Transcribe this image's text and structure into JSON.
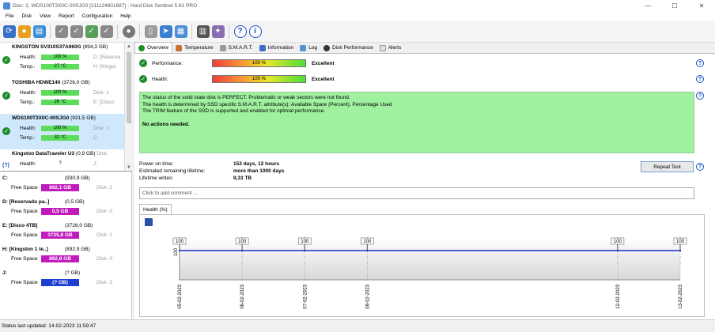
{
  "window": {
    "title": "Disc: 2, WDS100T3X0C-00SJG0 [211124801687]  -  Hard Disk Sentinel 5.61 PRO"
  },
  "menu": [
    "File",
    "Disk",
    "View",
    "Report",
    "Configuration",
    "Help"
  ],
  "disks": [
    {
      "name": "KINGSTON SV310S37A960G",
      "size": "(894,3 GB)",
      "health": "100 %",
      "temp": "27 °C",
      "side1": "D: [Reserva",
      "side2": "H: [Kingst",
      "status": "ok"
    },
    {
      "name": "TOSHIBA HDWE140",
      "size": "(3726,0 GB)",
      "health": "100 %",
      "temp": "26 °C",
      "side1": "Disk: 1",
      "side2": "E: [Disco ",
      "status": "ok"
    },
    {
      "name": "WDS100T3X0C-00SJG0",
      "size": "(931,5 GB)",
      "health": "100 %",
      "temp": "32 °C",
      "side1": "Disk: 2",
      "side2": "C:",
      "status": "ok"
    },
    {
      "name": "Kingston DataTraveler U3",
      "size": "(0,9 GB)",
      "health": "?",
      "temp": "",
      "side1": "J:",
      "side2": "",
      "side0": "Disk:",
      "status": "unknown"
    }
  ],
  "labels": {
    "health": "Health:",
    "temp": "Temp.:",
    "free_space": "Free Space"
  },
  "volumes": [
    {
      "name": "C:",
      "size": "(930,9 GB)",
      "free": "892,1 GB",
      "disk": "Disk: 2",
      "color": "#c21bbd"
    },
    {
      "name": "D: [Reservado pa..]",
      "size": "(0,5 GB)",
      "free": "0,5 GB",
      "disk": "Disk: 0",
      "color": "#c21bbd"
    },
    {
      "name": "E: [Disco  4TB]",
      "size": "(3726,0 GB)",
      "free": "3725,8 GB",
      "disk": "Disk: 1",
      "color": "#c21bbd"
    },
    {
      "name": "H: [Kingston 1 te..]",
      "size": "(892,9 GB)",
      "free": "892,8 GB",
      "disk": "Disk: 0",
      "color": "#c21bbd"
    },
    {
      "name": "J:",
      "size": "(? GB)",
      "free": "(? GB)",
      "disk": "Disk: 3",
      "color": "#1f3fd0"
    }
  ],
  "tabs": [
    "Overview",
    "Temperature",
    "S.M.A.R.T.",
    "Information",
    "Log",
    "Disk Performance",
    "Alerts"
  ],
  "overview": {
    "performance_label": "Performance:",
    "performance_value": "100 %",
    "performance_fraction": 1.0,
    "performance_text": "Excellent",
    "health_label": "Health:",
    "health_value": "100 %",
    "health_fraction": 1.0,
    "health_text": "Excellent",
    "message_lines": [
      "The status of the solid state disk is PERFECT. Problematic or weak sectors were not found.",
      "The health is determined by SSD specific S.M.A.R.T. attribute(s):  Available Spare (Percent), Percentage Used",
      "The TRIM feature of the SSD is supported and enabled for optimal performance."
    ],
    "message_bold": "No actions needed.",
    "power_on_label": "Power on time:",
    "power_on_value": "153 days, 12 hours",
    "remaining_label": "Estimated remaining lifetime:",
    "remaining_value": "more than 1000 days",
    "writes_label": "Lifetime writes:",
    "writes_value": "9,33 TB",
    "repeat_button": "Repeat Test",
    "comment_placeholder": "Click to add comment ...",
    "health_tab": "Health (%)"
  },
  "chart_data": {
    "type": "line",
    "x": [
      "05-02-2023",
      "06-02-2023",
      "07-02-2023",
      "08-02-2023",
      "12-02-2023",
      "13-02-2023"
    ],
    "y": [
      100,
      100,
      100,
      100,
      100,
      100
    ],
    "data_labels": [
      "100",
      "100",
      "100",
      "100",
      "100",
      "100"
    ],
    "ytick": "100",
    "series_color": "#1e2fc8"
  },
  "status": {
    "text": "Status last updated: 14-02-2023 11:59:47"
  }
}
